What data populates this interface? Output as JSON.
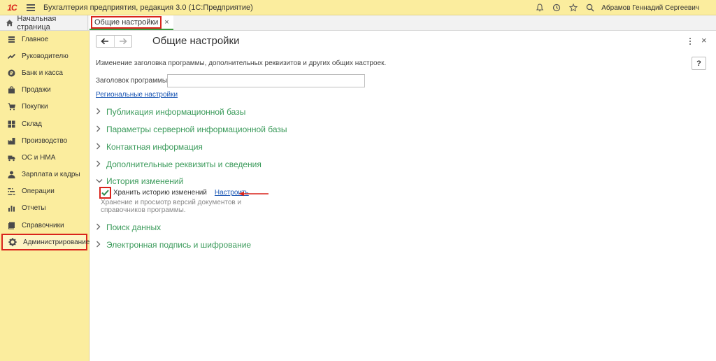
{
  "app": {
    "title": "Бухгалтерия предприятия, редакция 3.0  (1С:Предприятие)",
    "logo_text": "1С",
    "user": "Абрамов Геннадий Сергеевич"
  },
  "tabs": {
    "home": "Начальная страница",
    "active": "Общие настройки",
    "close": "×"
  },
  "sidebar": {
    "items": [
      {
        "label": "Главное",
        "icon": "list-icon"
      },
      {
        "label": "Руководителю",
        "icon": "trend-icon"
      },
      {
        "label": "Банк и касса",
        "icon": "coin-icon"
      },
      {
        "label": "Продажи",
        "icon": "bag-icon"
      },
      {
        "label": "Покупки",
        "icon": "cart-icon"
      },
      {
        "label": "Склад",
        "icon": "warehouse-icon"
      },
      {
        "label": "Производство",
        "icon": "factory-icon"
      },
      {
        "label": "ОС и НМА",
        "icon": "truck-icon"
      },
      {
        "label": "Зарплата и кадры",
        "icon": "person-icon"
      },
      {
        "label": "Операции",
        "icon": "operations-icon"
      },
      {
        "label": "Отчеты",
        "icon": "bar-chart-icon"
      },
      {
        "label": "Справочники",
        "icon": "book-icon"
      },
      {
        "label": "Администрирование",
        "icon": "gear-icon"
      }
    ]
  },
  "form": {
    "title": "Общие настройки",
    "help": "?",
    "close": "×",
    "description": "Изменение заголовка программы, дополнительных реквизитов и других общих настроек.",
    "program_title_label": "Заголовок программы:",
    "program_title_value": "",
    "regional_link": "Региональные настройки",
    "sections": [
      {
        "title": "Публикация информационной базы",
        "expanded": false
      },
      {
        "title": "Параметры серверной информационной базы",
        "expanded": false
      },
      {
        "title": "Контактная информация",
        "expanded": false
      },
      {
        "title": "Дополнительные реквизиты и сведения",
        "expanded": false
      },
      {
        "title": "История изменений",
        "expanded": true
      },
      {
        "title": "Поиск данных",
        "expanded": false
      },
      {
        "title": "Электронная подпись и шифрование",
        "expanded": false
      }
    ],
    "history": {
      "checkbox_label": "Хранить историю изменений",
      "checked": true,
      "configure_link": "Настроить",
      "description": "Хранение и просмотр версий документов и справочников программы."
    }
  },
  "colors": {
    "accent_green": "#3a9a5a",
    "highlight_red": "#d9241c",
    "panel_yellow": "#fbed9e",
    "link_blue": "#1a56b4"
  }
}
